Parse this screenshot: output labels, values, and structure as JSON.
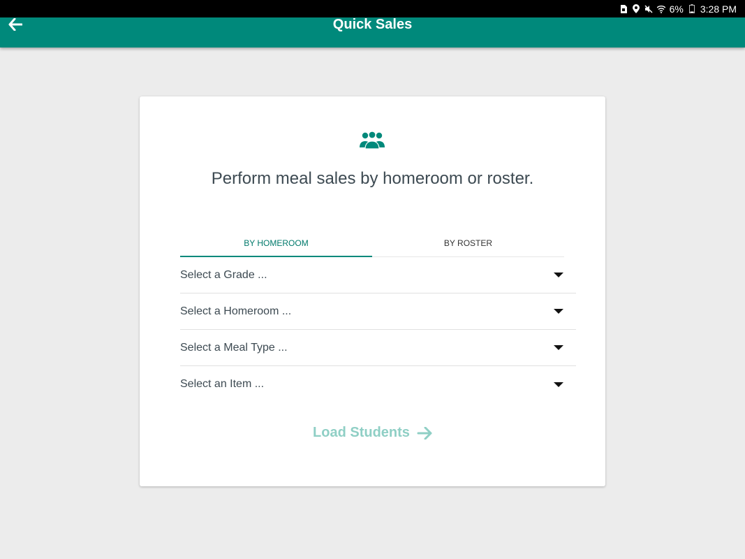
{
  "status_bar": {
    "icons": [
      "sim-icon",
      "location-icon",
      "mute-icon",
      "wifi-icon",
      "battery-icon"
    ],
    "battery": "6%",
    "time": "3:28 PM"
  },
  "app_bar": {
    "title": "Quick Sales",
    "color": "#00897b",
    "back_icon": "arrow-left-icon"
  },
  "card": {
    "icon": "group-icon",
    "headline": "Perform meal sales by homeroom or roster.",
    "tabs": [
      {
        "label": "BY HOMEROOM",
        "active": true
      },
      {
        "label": "BY ROSTER",
        "active": false
      }
    ],
    "selects": [
      {
        "placeholder": "Select a Grade ..."
      },
      {
        "placeholder": "Select a Homeroom ..."
      },
      {
        "placeholder": "Select a Meal Type ..."
      },
      {
        "placeholder": "Select an Item ..."
      }
    ],
    "load_button": {
      "label": "Load Students",
      "icon": "arrow-right-icon",
      "disabled": true
    }
  }
}
